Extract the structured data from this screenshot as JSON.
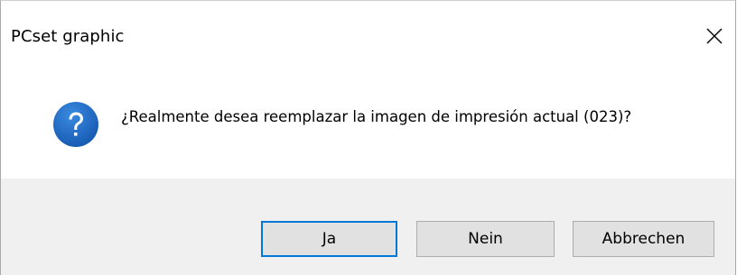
{
  "window": {
    "title": "PCset graphic",
    "close_icon": "close-icon"
  },
  "message": {
    "icon": "question-icon",
    "text": "¿Realmente desea reemplazar la imagen de impresión actual (023)?"
  },
  "buttons": {
    "yes_label": "Ja",
    "no_label": "Nein",
    "cancel_label": "Abbrechen"
  },
  "colors": {
    "accent": "#0078d7",
    "icon_blue": "#1f5fb3",
    "button_bar": "#f0f0f0",
    "button_face": "#e1e1e1"
  }
}
